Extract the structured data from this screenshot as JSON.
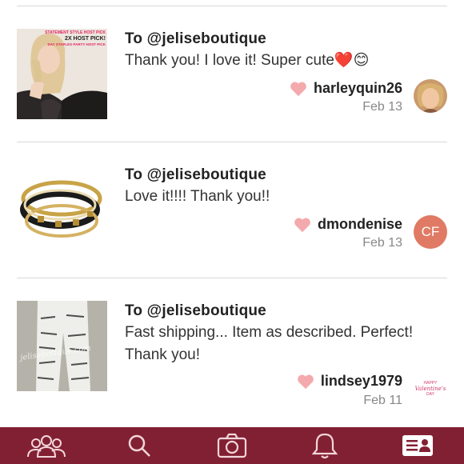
{
  "feedback": [
    {
      "recipient": "To @jeliseboutique",
      "message": "Thank you! I love it! Super cute❤️😊",
      "username": "harleyquin26",
      "date": "Feb 13",
      "thumb_text": [
        "STATEMENT STYLE HOST PICK",
        "2X HOST PICK!",
        "DAY STAPLES PARTY HOST PICK"
      ],
      "avatar": "photo"
    },
    {
      "recipient": "To @jeliseboutique",
      "message": "Love it!!!! Thank you!!",
      "username": "dmondenise",
      "date": "Feb 13",
      "avatar_initials": "CF"
    },
    {
      "recipient": "To @jeliseboutique",
      "message": "Fast shipping... Item as described. Perfect! Thank you!",
      "username": "lindsey1979",
      "date": "Feb 11",
      "thumb_watermark": "jelisebotique.com",
      "avatar_text": [
        "HAPPY",
        "Valentine's",
        "DAY"
      ]
    }
  ],
  "tabbar": {
    "items": [
      "community-icon",
      "search-icon",
      "camera-icon",
      "bell-icon",
      "profile-card-icon"
    ],
    "active": "profile-card-icon"
  },
  "colors": {
    "tabbar": "#822033",
    "heart": "#f4a9ad",
    "avatar_cf": "#e07a64"
  }
}
